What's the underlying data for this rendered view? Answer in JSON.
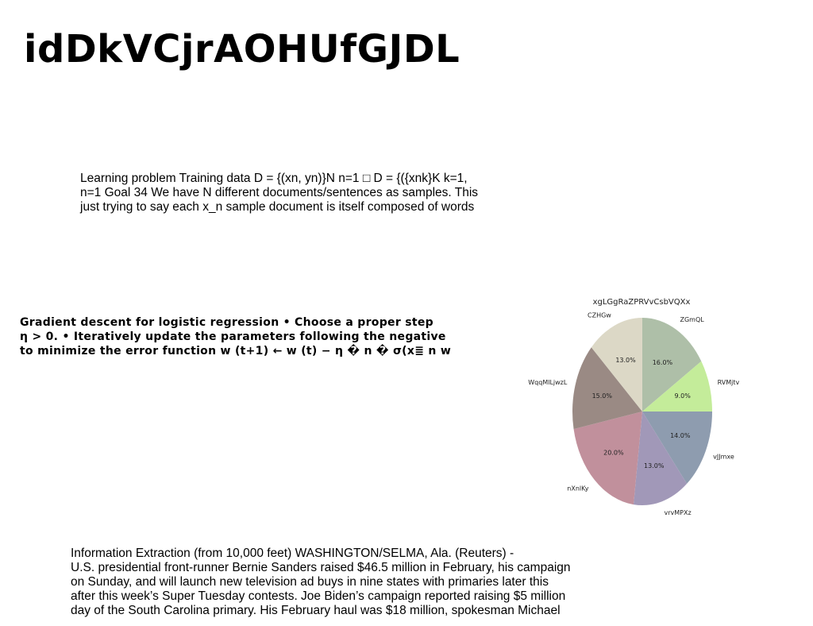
{
  "title": "idDkVCjrAOHUfGJDL",
  "paragraph1": {
    "lines": [
      "Learning problem Training data D = {(xn, yn)}N n=1 □ D = {({xnk}K k=1,",
      "n=1 Goal 34 We have N different documents/sentences as samples. This",
      "just trying to say each x_n sample document is itself composed of words"
    ]
  },
  "paragraph2": {
    "lines": [
      "Gradient descent for logistic regression • Choose a proper step",
      "η > 0. • Iteratively update the parameters following the negative",
      "to minimize the error function w (t+1) ← w (t) − η � n � σ(x≣ n w"
    ]
  },
  "paragraph3": {
    "lines": [
      "Information Extraction (from 10,000 feet) WASHINGTON/SELMA, Ala. (Reuters) -",
      "U.S. presidential front-runner Bernie Sanders raised $46.5 million in February, his campaign",
      "on Sunday, and will launch new television ad buys in nine states with primaries later this",
      "after this week’s Super Tuesday contests. Joe Biden’s campaign reported raising $5 million",
      "day of the South Carolina primary. His February haul was $18 million, spokesman Michael"
    ]
  },
  "chart_data": {
    "type": "pie",
    "title": "xgLGgRaZPRVvCsbVQXx",
    "start_angle_deg": 90,
    "direction": "clockwise",
    "slices": [
      {
        "label": "ZGmQL",
        "value": 16.0,
        "pct_label": "16.0%",
        "color": "#aebfa8"
      },
      {
        "label": "RVMjtv",
        "value": 9.0,
        "pct_label": "9.0%",
        "color": "#c4ec9a"
      },
      {
        "label": "vJJmxe",
        "value": 14.0,
        "pct_label": "14.0%",
        "color": "#8e9caf"
      },
      {
        "label": "vrvMPXz",
        "value": 13.0,
        "pct_label": "13.0%",
        "color": "#a198b8"
      },
      {
        "label": "nXnlKy",
        "value": 20.0,
        "pct_label": "20.0%",
        "color": "#c1909c"
      },
      {
        "label": "WqqMlLjwzL",
        "value": 15.0,
        "pct_label": "15.0%",
        "color": "#9a8a84"
      },
      {
        "label": "CZHGw",
        "value": 13.0,
        "pct_label": "13.0%",
        "color": "#dcd8c6"
      }
    ]
  }
}
